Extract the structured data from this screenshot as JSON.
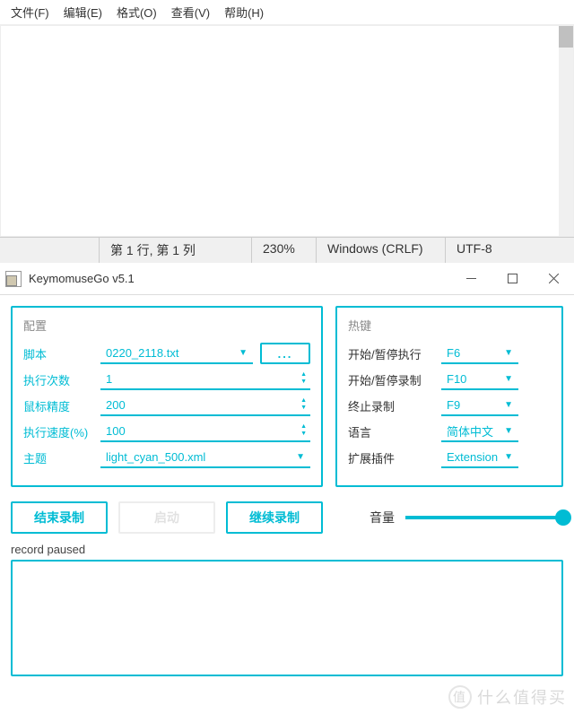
{
  "notepad": {
    "menu": {
      "file": "文件(F)",
      "edit": "编辑(E)",
      "format": "格式(O)",
      "view": "查看(V)",
      "help": "帮助(H)"
    },
    "status": {
      "position": "第 1 行, 第 1 列",
      "zoom": "230%",
      "eol": "Windows (CRLF)",
      "encoding": "UTF-8"
    }
  },
  "app": {
    "title": "KeymomuseGo v5.1",
    "config": {
      "heading": "配置",
      "labels": {
        "script": "脚本",
        "times": "执行次数",
        "precision": "鼠标精度",
        "speed": "执行速度(%)",
        "theme": "主题"
      },
      "script_value": "0220_2118.txt",
      "browse": "...",
      "times_value": "1",
      "precision_value": "200",
      "speed_value": "100",
      "theme_value": "light_cyan_500.xml"
    },
    "hotkey": {
      "heading": "热键",
      "labels": {
        "startExec": "开始/暂停执行",
        "startRec": "开始/暂停录制",
        "stopRec": "终止录制",
        "lang": "语言",
        "ext": "扩展插件"
      },
      "startExec": "F6",
      "startRec": "F10",
      "stopRec": "F9",
      "lang": "简体中文",
      "ext": "Extension"
    },
    "buttons": {
      "stopRec": "结束录制",
      "run": "启动",
      "contRec": "继续录制"
    },
    "volume_label": "音量",
    "status_text": "record paused"
  },
  "watermark": "什么值得买"
}
